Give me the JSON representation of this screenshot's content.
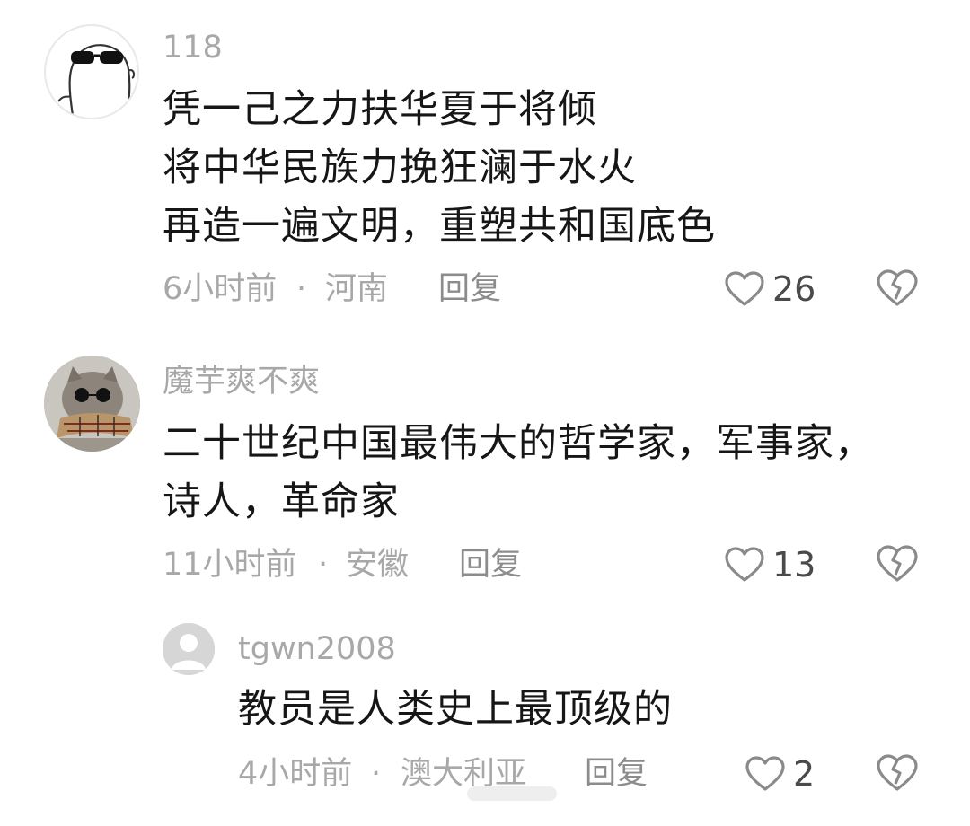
{
  "comments": [
    {
      "username": "118",
      "lines": [
        "凭一己之力扶华夏于将倾",
        "将中华民族力挽狂澜于水火",
        "再造一遍文明，重塑共和国底色"
      ],
      "time": "6小时前",
      "location": "河南",
      "reply_label": "回复",
      "likes": "26"
    },
    {
      "username": "魔芋爽不爽",
      "lines": [
        "二十世纪中国最伟大的哲学家，军事家，",
        "诗人，革命家"
      ],
      "time": "11小时前",
      "location": "安徽",
      "reply_label": "回复",
      "likes": "13",
      "replies": [
        {
          "username": "tgwn2008",
          "lines": [
            "教员是人类史上最顶级的"
          ],
          "time": "4小时前",
          "location": "澳大利亚",
          "reply_label": "回复",
          "likes": "2"
        }
      ]
    }
  ],
  "meta_separator": "·",
  "icons": {
    "like": "heart-outline-icon",
    "dislike": "broken-heart-icon"
  },
  "colors": {
    "username": "#a8a8a8",
    "text": "#161616",
    "meta": "#a8a8a8",
    "icon": "#8a8a8a"
  }
}
